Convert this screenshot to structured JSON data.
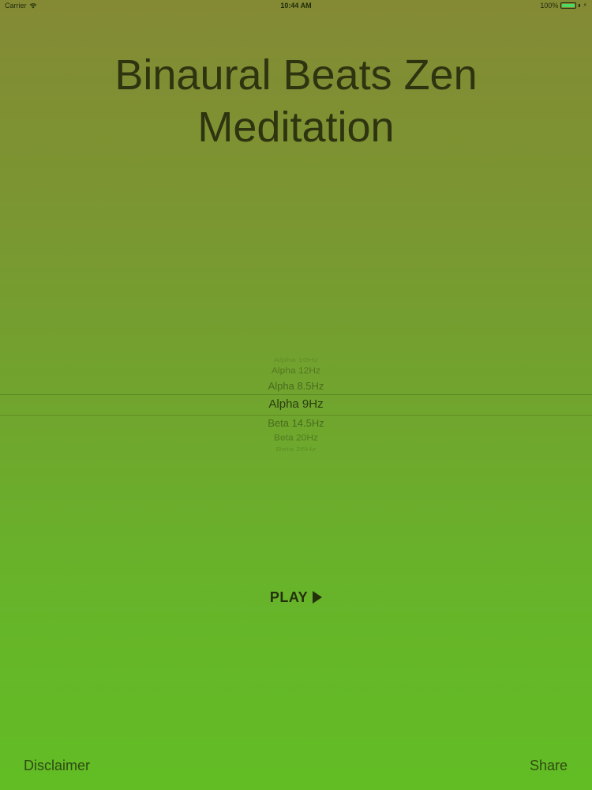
{
  "status_bar": {
    "carrier": "Carrier",
    "time": "10:44 AM",
    "battery": "100%",
    "battery_level": 1.0,
    "icons": [
      "wifi-icon",
      "battery-icon",
      "charging-bolt-icon"
    ]
  },
  "title": {
    "line1": "Binaural Beats Zen",
    "line2": "Meditation"
  },
  "picker": {
    "items": [
      "Alpha 10Hz",
      "Alpha 12Hz",
      "Alpha 8.5Hz",
      "Alpha 9Hz",
      "Beta 14.5Hz",
      "Beta 20Hz",
      "Beta 26Hz"
    ],
    "selected": "Alpha 9Hz"
  },
  "play": {
    "label": "PLAY",
    "icon": "play-triangle-icon"
  },
  "footer": {
    "disclaimer": "Disclaimer",
    "share": "Share"
  },
  "colors": {
    "background_top": "#848a34",
    "background_bottom": "#62bd24",
    "text_dark": "#2e3410",
    "battery_fill": "#4cd964"
  }
}
